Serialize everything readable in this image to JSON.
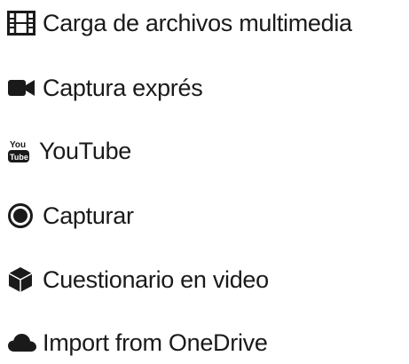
{
  "menu": {
    "items": [
      {
        "label": "Carga de archivos multimedia",
        "icon": "film-icon"
      },
      {
        "label": "Captura exprés",
        "icon": "video-camera-icon"
      },
      {
        "label": "YouTube",
        "icon": "youtube-icon"
      },
      {
        "label": "Capturar",
        "icon": "record-icon"
      },
      {
        "label": "Cuestionario en video",
        "icon": "cube-icon"
      },
      {
        "label": "Import from OneDrive",
        "icon": "cloud-icon"
      }
    ]
  },
  "colors": {
    "text": "#1a1a1a",
    "icon": "#1a1a1a",
    "background": "#ffffff"
  }
}
